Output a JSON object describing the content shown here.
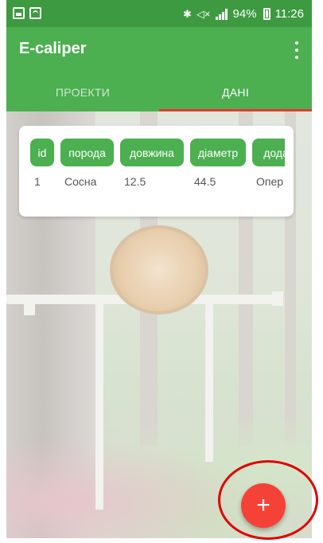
{
  "status_bar": {
    "time": "11:26",
    "battery": "94%",
    "icons": [
      "gallery-icon",
      "wifi-icon",
      "bluetooth-icon",
      "mute-icon",
      "signal-icon",
      "battery-icon"
    ]
  },
  "app_bar": {
    "title": "E-caliper",
    "menu_icon": "overflow-menu-icon"
  },
  "tabs": [
    {
      "label": "ПРОЕКТИ",
      "active": false
    },
    {
      "label": "ДАНІ",
      "active": true
    }
  ],
  "table": {
    "columns": [
      "id",
      "порода",
      "довжина",
      "діаметр",
      "дода"
    ],
    "rows": [
      [
        "1",
        "Сосна",
        "12.5",
        "44.5",
        "Опер"
      ]
    ]
  },
  "fab": {
    "icon": "plus-icon",
    "symbol": "+"
  },
  "colors": {
    "status_bar": "#3d9a40",
    "primary": "#4caf50",
    "tab_indicator": "#e53935",
    "fab": "#f44336",
    "annotation": "#e00000"
  }
}
